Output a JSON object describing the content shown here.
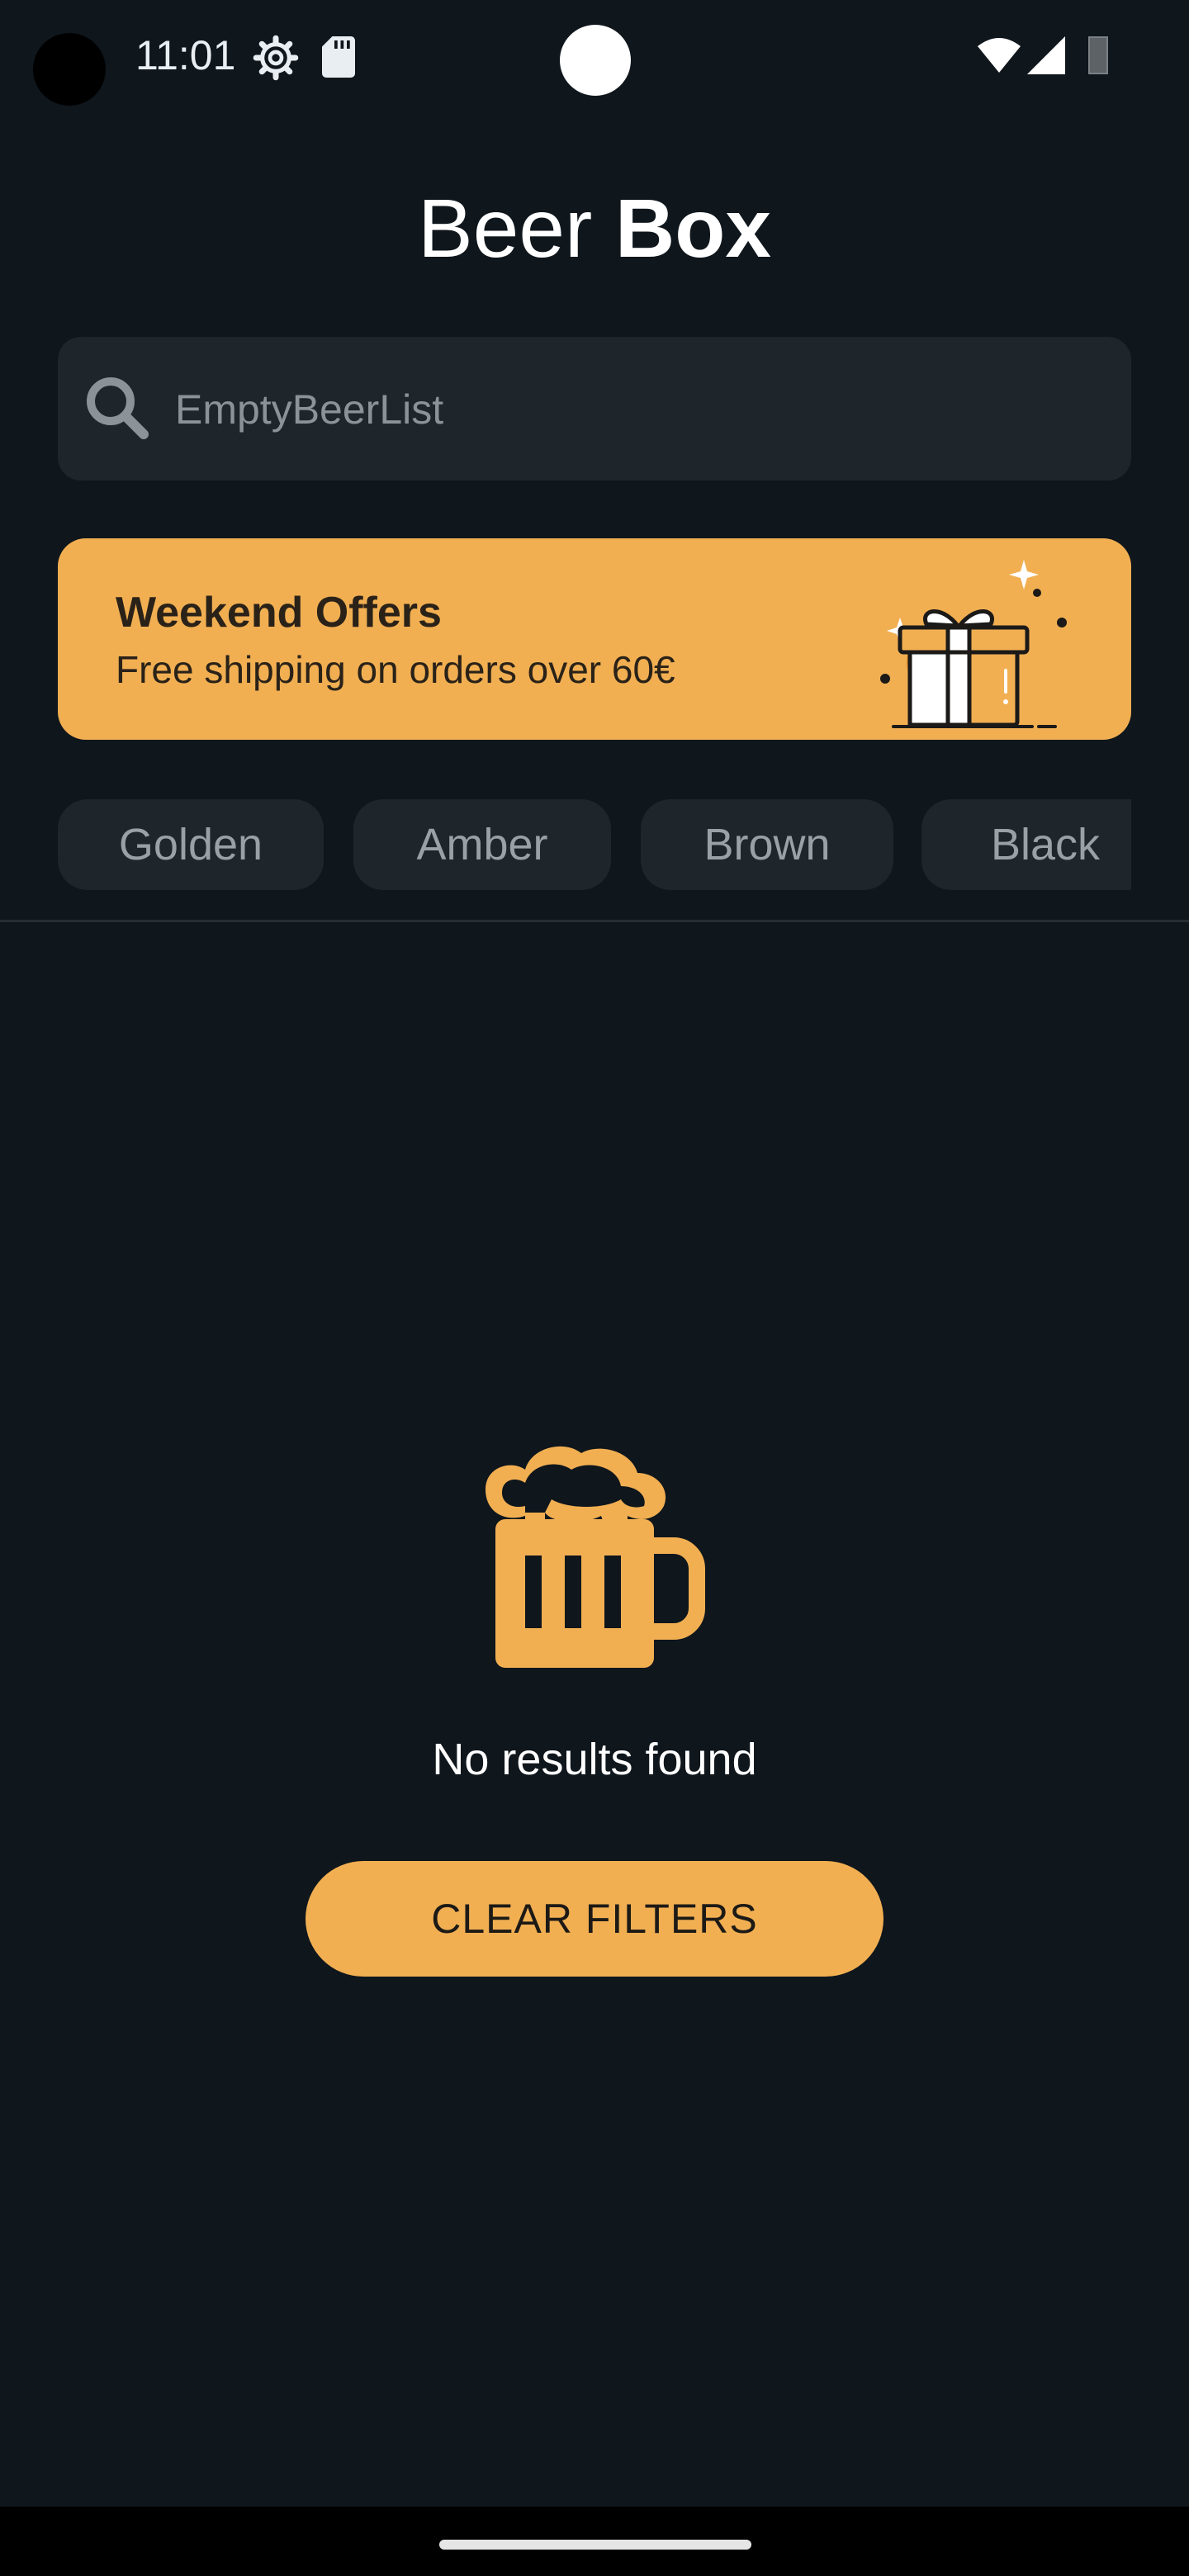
{
  "status_bar": {
    "time": "11:01",
    "icons": [
      "settings-gear-icon",
      "sd-card-icon",
      "wifi-icon",
      "cell-signal-icon",
      "battery-icon"
    ]
  },
  "header": {
    "title_light": "Beer ",
    "title_bold": "Box"
  },
  "search": {
    "placeholder": "EmptyBeerList",
    "value": ""
  },
  "offer": {
    "title": "Weekend Offers",
    "subtitle": "Free shipping on orders over 60€",
    "icon": "gift-icon"
  },
  "filters": {
    "chips": [
      {
        "label": "Golden"
      },
      {
        "label": "Amber"
      },
      {
        "label": "Brown"
      },
      {
        "label": "Black"
      }
    ]
  },
  "empty_state": {
    "icon": "beer-mug-icon",
    "message": "No results found",
    "button_label": "CLEAR FILTERS"
  },
  "colors": {
    "background": "#0f161c",
    "surface": "#1e252b",
    "accent": "#f1af52",
    "text_primary": "#ffffff",
    "text_muted": "#9aa1a6"
  }
}
